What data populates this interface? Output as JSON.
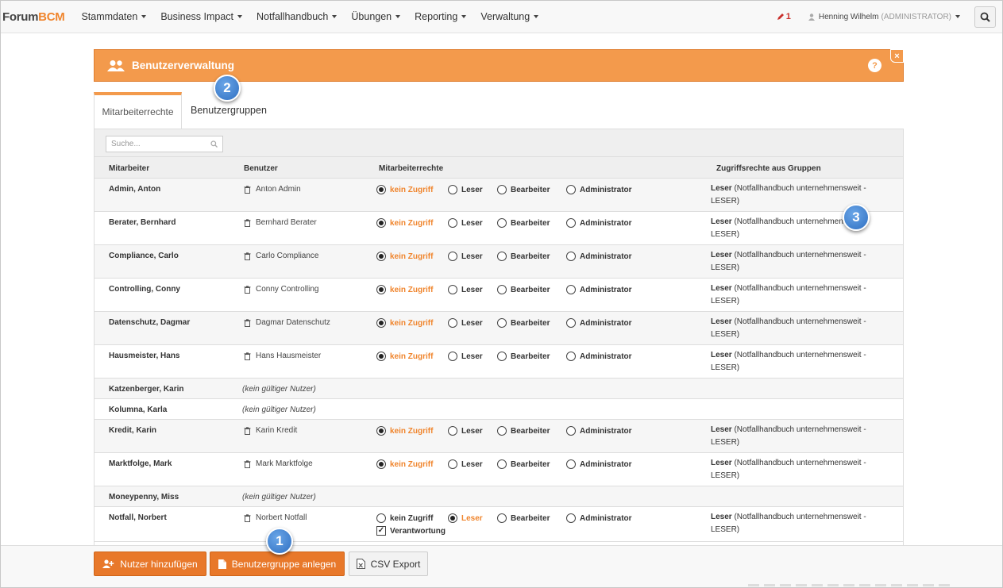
{
  "brand": {
    "part1": "Forum",
    "part2": "BCM"
  },
  "nav": {
    "items": [
      {
        "label": "Stammdaten"
      },
      {
        "label": "Business Impact"
      },
      {
        "label": "Notfallhandbuch"
      },
      {
        "label": "Übungen"
      },
      {
        "label": "Reporting"
      },
      {
        "label": "Verwaltung"
      }
    ],
    "notifications": "1",
    "user_name": "Henning Wilhelm",
    "user_role": "(ADMINISTRATOR)"
  },
  "panel": {
    "title": "Benutzerverwaltung",
    "help": "?",
    "close": "×"
  },
  "tabs": [
    {
      "label": "Mitarbeiterrechte"
    },
    {
      "label": "Benutzergruppen"
    }
  ],
  "search": {
    "placeholder": "Suche..."
  },
  "columns": {
    "mitarbeiter": "Mitarbeiter",
    "benutzer": "Benutzer",
    "rechte": "Mitarbeiterrechte",
    "gruppen": "Zugriffsrechte aus Gruppen"
  },
  "options": {
    "none": "kein Zugriff",
    "reader": "Leser",
    "editor": "Bearbeiter",
    "admin": "Administrator",
    "responsibility": "Verantwortung"
  },
  "invalid_user": "(kein gültiger Nutzer)",
  "rights_prefix": "Leser",
  "rights_text": " (Notfallhandbuch unternehmensweit - LESER)",
  "rows": [
    {
      "name": "Admin, Anton",
      "user": "Anton Admin"
    },
    {
      "name": "Berater, Bernhard",
      "user": "Bernhard Berater"
    },
    {
      "name": "Compliance, Carlo",
      "user": "Carlo Compliance"
    },
    {
      "name": "Controlling, Conny",
      "user": "Conny Controlling"
    },
    {
      "name": "Datenschutz, Dagmar",
      "user": "Dagmar Datenschutz"
    },
    {
      "name": "Hausmeister, Hans",
      "user": "Hans Hausmeister"
    },
    {
      "name": "Katzenberger, Karin"
    },
    {
      "name": "Kolumna, Karla"
    },
    {
      "name": "Kredit, Karin",
      "user": "Karin Kredit"
    },
    {
      "name": "Marktfolge, Mark",
      "user": "Mark Marktfolge"
    },
    {
      "name": "Moneypenny, Miss"
    },
    {
      "name": "Notfall, Norbert",
      "user": "Norbert Notfall"
    }
  ],
  "footer": {
    "add_user": "Nutzer hinzufügen",
    "add_group": "Benutzergruppe anlegen",
    "csv": "CSV Export"
  },
  "callouts": [
    "1",
    "2",
    "3"
  ],
  "colors": {
    "accent": "#f39a4c",
    "button": "#e8782a",
    "callout": "#2f6fc1"
  }
}
